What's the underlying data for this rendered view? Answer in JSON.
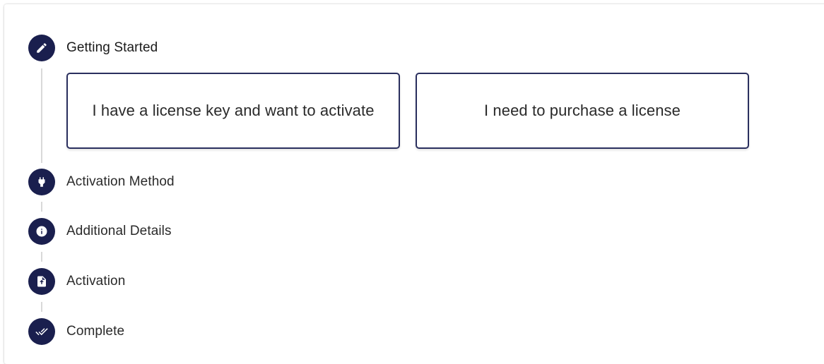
{
  "stepper": {
    "steps": [
      {
        "label": "Getting Started",
        "icon": "pencil-icon",
        "active": true
      },
      {
        "label": "Activation Method",
        "icon": "plug-icon",
        "active": false
      },
      {
        "label": "Additional Details",
        "icon": "info-icon",
        "active": false
      },
      {
        "label": "Activation",
        "icon": "file-upload-icon",
        "active": false
      },
      {
        "label": "Complete",
        "icon": "done-all-icon",
        "active": false
      }
    ]
  },
  "options": {
    "have_license": "I have a license key and want to activate",
    "purchase_license": "I need to purchase a license"
  },
  "colors": {
    "accent": "#1a1f4e",
    "connector": "#d9d9d9",
    "card_border": "#2a2f5e"
  }
}
